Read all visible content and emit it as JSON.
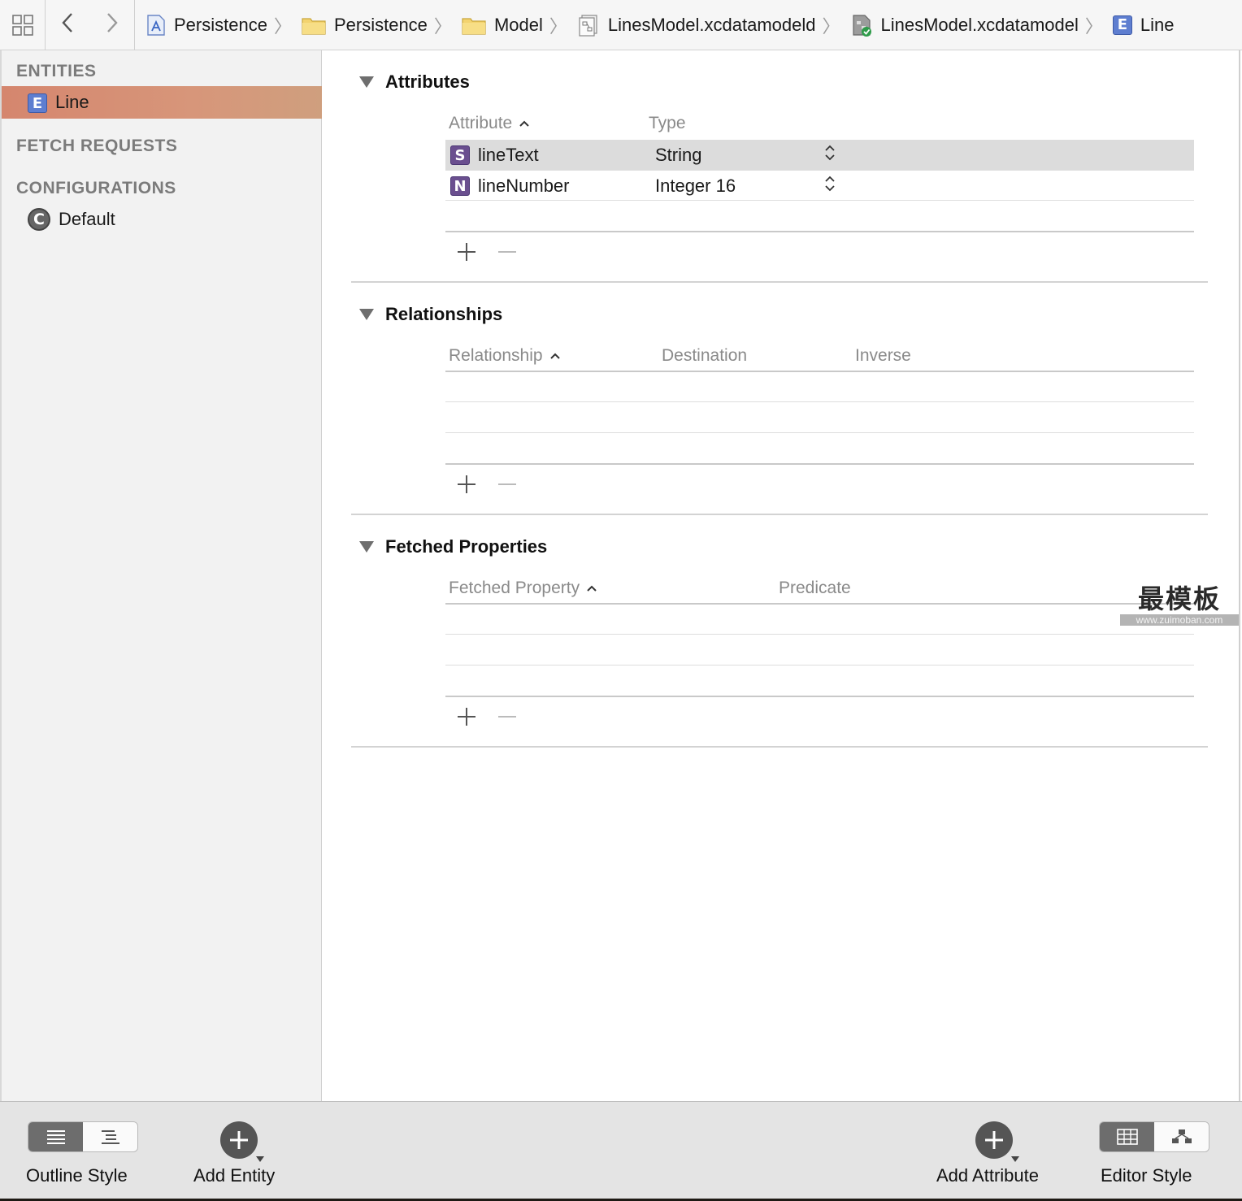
{
  "breadcrumbs": [
    {
      "label": "Persistence",
      "icon": "project-icon"
    },
    {
      "label": "Persistence",
      "icon": "folder-icon"
    },
    {
      "label": "Model",
      "icon": "folder-icon"
    },
    {
      "label": "LinesModel.xcdatamodeld",
      "icon": "datamodel-bundle-icon"
    },
    {
      "label": "LinesModel.xcdatamodel",
      "icon": "datamodel-file-icon"
    },
    {
      "label": "Line",
      "icon": "entity-icon"
    }
  ],
  "sidebar": {
    "entities_header": "ENTITIES",
    "entities": [
      {
        "label": "Line",
        "badge": "E",
        "selected": true
      }
    ],
    "fetch_requests_header": "FETCH REQUESTS",
    "configurations_header": "CONFIGURATIONS",
    "configurations": [
      {
        "label": "Default",
        "badge": "C"
      }
    ]
  },
  "attributes": {
    "title": "Attributes",
    "col_attribute": "Attribute",
    "col_type": "Type",
    "rows": [
      {
        "badge": "S",
        "name": "lineText",
        "type": "String",
        "selected": true
      },
      {
        "badge": "N",
        "name": "lineNumber",
        "type": "Integer 16",
        "selected": false
      }
    ]
  },
  "relationships": {
    "title": "Relationships",
    "col_relationship": "Relationship",
    "col_destination": "Destination",
    "col_inverse": "Inverse"
  },
  "fetched_properties": {
    "title": "Fetched Properties",
    "col_fetched_property": "Fetched Property",
    "col_predicate": "Predicate"
  },
  "bottom": {
    "outline_style": "Outline Style",
    "add_entity": "Add Entity",
    "add_attribute": "Add Attribute",
    "editor_style": "Editor Style"
  },
  "watermark": {
    "big": "最模板",
    "small": "www.zuimoban.com"
  },
  "colors": {
    "selection_accent": "#d5866e",
    "entity_badge": "#5e7ed0",
    "attribute_badge": "#6a4f8f",
    "row_selected": "#dcdcdc"
  }
}
